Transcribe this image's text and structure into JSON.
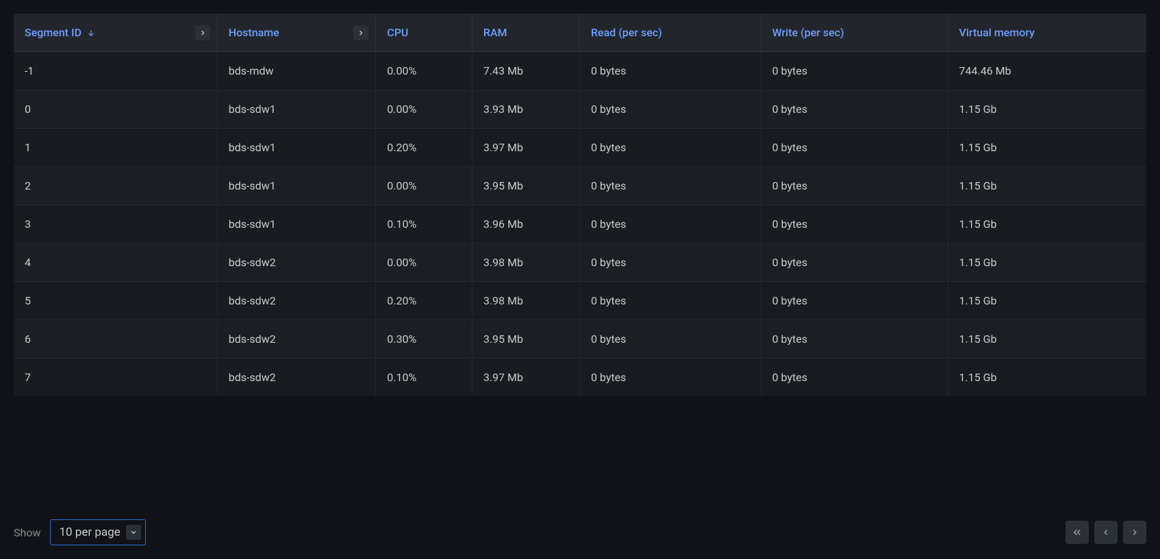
{
  "table": {
    "headers": {
      "segment": "Segment ID",
      "hostname": "Hostname",
      "cpu": "CPU",
      "ram": "RAM",
      "read": "Read (per sec)",
      "write": "Write (per sec)",
      "vmem": "Virtual memory"
    },
    "rows": [
      {
        "segment": "-1",
        "hostname": "bds-mdw",
        "cpu": "0.00%",
        "ram": "7.43 Mb",
        "read": "0 bytes",
        "write": "0 bytes",
        "vmem": "744.46 Mb"
      },
      {
        "segment": "0",
        "hostname": "bds-sdw1",
        "cpu": "0.00%",
        "ram": "3.93 Mb",
        "read": "0 bytes",
        "write": "0 bytes",
        "vmem": "1.15 Gb"
      },
      {
        "segment": "1",
        "hostname": "bds-sdw1",
        "cpu": "0.20%",
        "ram": "3.97 Mb",
        "read": "0 bytes",
        "write": "0 bytes",
        "vmem": "1.15 Gb"
      },
      {
        "segment": "2",
        "hostname": "bds-sdw1",
        "cpu": "0.00%",
        "ram": "3.95 Mb",
        "read": "0 bytes",
        "write": "0 bytes",
        "vmem": "1.15 Gb"
      },
      {
        "segment": "3",
        "hostname": "bds-sdw1",
        "cpu": "0.10%",
        "ram": "3.96 Mb",
        "read": "0 bytes",
        "write": "0 bytes",
        "vmem": "1.15 Gb"
      },
      {
        "segment": "4",
        "hostname": "bds-sdw2",
        "cpu": "0.00%",
        "ram": "3.98 Mb",
        "read": "0 bytes",
        "write": "0 bytes",
        "vmem": "1.15 Gb"
      },
      {
        "segment": "5",
        "hostname": "bds-sdw2",
        "cpu": "0.20%",
        "ram": "3.98 Mb",
        "read": "0 bytes",
        "write": "0 bytes",
        "vmem": "1.15 Gb"
      },
      {
        "segment": "6",
        "hostname": "bds-sdw2",
        "cpu": "0.30%",
        "ram": "3.95 Mb",
        "read": "0 bytes",
        "write": "0 bytes",
        "vmem": "1.15 Gb"
      },
      {
        "segment": "7",
        "hostname": "bds-sdw2",
        "cpu": "0.10%",
        "ram": "3.97 Mb",
        "read": "0 bytes",
        "write": "0 bytes",
        "vmem": "1.15 Gb"
      }
    ]
  },
  "pagination": {
    "show_label": "Show",
    "page_size_label": "10 per page"
  }
}
